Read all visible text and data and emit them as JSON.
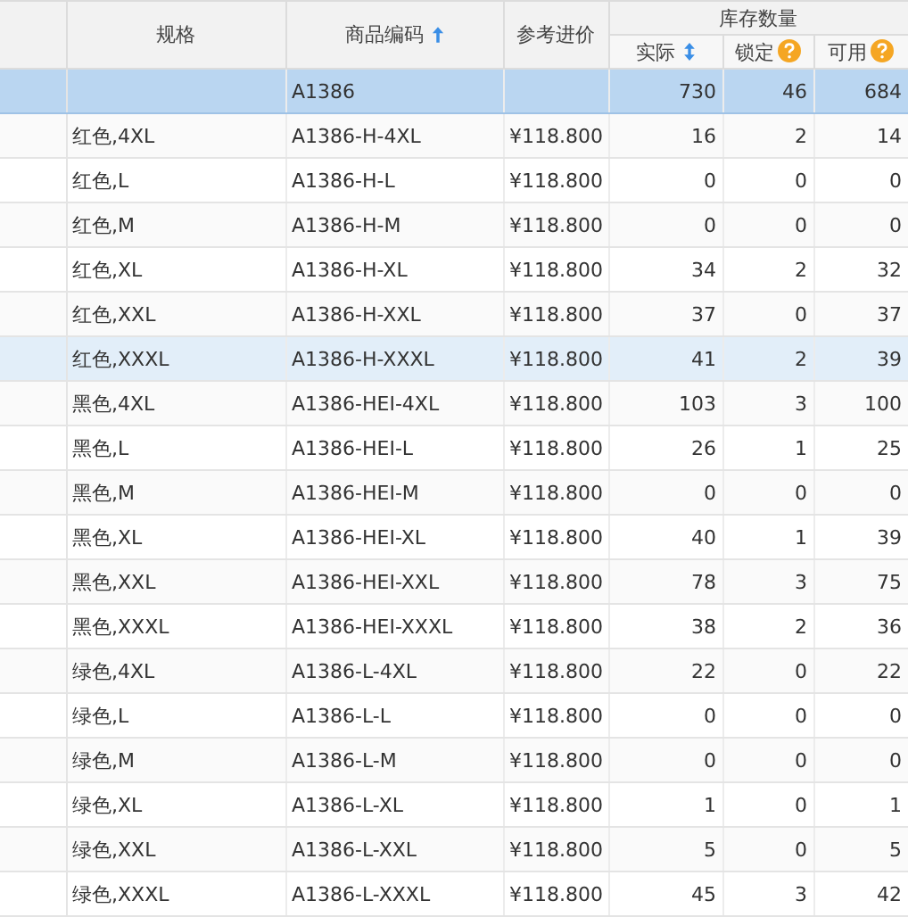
{
  "header": {
    "columns": [
      {
        "label": "规格",
        "kind": "plain"
      },
      {
        "label": "商品编码",
        "kind": "ascending"
      },
      {
        "label": "参考进价",
        "kind": "plain"
      }
    ],
    "stock": {
      "label": "库存数量",
      "columns": [
        {
          "label": "实际",
          "kind": "sortable"
        },
        {
          "label": "锁定",
          "kind": "help"
        },
        {
          "label": "可用",
          "kind": "help"
        }
      ]
    }
  },
  "rows": [
    {
      "code": "A1386",
      "actual": "730",
      "locked": "46",
      "available": "684",
      "selected": true,
      "hovered": false
    },
    {
      "spec": "红色,4XL",
      "code": "A1386-H-4XL",
      "price": "¥118.800",
      "actual": "16",
      "locked": "2",
      "available": "14",
      "selected": false,
      "hovered": false
    },
    {
      "spec": "红色,L",
      "code": "A1386-H-L",
      "price": "¥118.800",
      "actual": "0",
      "locked": "0",
      "available": "0",
      "selected": false,
      "hovered": false
    },
    {
      "spec": "红色,M",
      "code": "A1386-H-M",
      "price": "¥118.800",
      "actual": "0",
      "locked": "0",
      "available": "0",
      "selected": false,
      "hovered": false
    },
    {
      "spec": "红色,XL",
      "code": "A1386-H-XL",
      "price": "¥118.800",
      "actual": "34",
      "locked": "2",
      "available": "32",
      "selected": false,
      "hovered": false
    },
    {
      "spec": "红色,XXL",
      "code": "A1386-H-XXL",
      "price": "¥118.800",
      "actual": "37",
      "locked": "0",
      "available": "37",
      "selected": false,
      "hovered": false
    },
    {
      "spec": "红色,XXXL",
      "code": "A1386-H-XXXL",
      "price": "¥118.800",
      "actual": "41",
      "locked": "2",
      "available": "39",
      "selected": false,
      "hovered": true
    },
    {
      "spec": "黑色,4XL",
      "code": "A1386-HEI-4XL",
      "price": "¥118.800",
      "actual": "103",
      "locked": "3",
      "available": "100",
      "selected": false,
      "hovered": false
    },
    {
      "spec": "黑色,L",
      "code": "A1386-HEI-L",
      "price": "¥118.800",
      "actual": "26",
      "locked": "1",
      "available": "25",
      "selected": false,
      "hovered": false
    },
    {
      "spec": "黑色,M",
      "code": "A1386-HEI-M",
      "price": "¥118.800",
      "actual": "0",
      "locked": "0",
      "available": "0",
      "selected": false,
      "hovered": false
    },
    {
      "spec": "黑色,XL",
      "code": "A1386-HEI-XL",
      "price": "¥118.800",
      "actual": "40",
      "locked": "1",
      "available": "39",
      "selected": false,
      "hovered": false
    },
    {
      "spec": "黑色,XXL",
      "code": "A1386-HEI-XXL",
      "price": "¥118.800",
      "actual": "78",
      "locked": "3",
      "available": "75",
      "selected": false,
      "hovered": false
    },
    {
      "spec": "黑色,XXXL",
      "code": "A1386-HEI-XXXL",
      "price": "¥118.800",
      "actual": "38",
      "locked": "2",
      "available": "36",
      "selected": false,
      "hovered": false
    },
    {
      "spec": "绿色,4XL",
      "code": "A1386-L-4XL",
      "price": "¥118.800",
      "actual": "22",
      "locked": "0",
      "available": "22",
      "selected": false,
      "hovered": false
    },
    {
      "spec": "绿色,L",
      "code": "A1386-L-L",
      "price": "¥118.800",
      "actual": "0",
      "locked": "0",
      "available": "0",
      "selected": false,
      "hovered": false
    },
    {
      "spec": "绿色,M",
      "code": "A1386-L-M",
      "price": "¥118.800",
      "actual": "0",
      "locked": "0",
      "available": "0",
      "selected": false,
      "hovered": false
    },
    {
      "spec": "绿色,XL",
      "code": "A1386-L-XL",
      "price": "¥118.800",
      "actual": "1",
      "locked": "0",
      "available": "1",
      "selected": false,
      "hovered": false
    },
    {
      "spec": "绿色,XXL",
      "code": "A1386-L-XXL",
      "price": "¥118.800",
      "actual": "5",
      "locked": "0",
      "available": "5",
      "selected": false,
      "hovered": false
    },
    {
      "spec": "绿色,XXXL",
      "code": "A1386-L-XXXL",
      "price": "¥118.800",
      "actual": "45",
      "locked": "3",
      "available": "42",
      "selected": false,
      "hovered": false
    }
  ]
}
